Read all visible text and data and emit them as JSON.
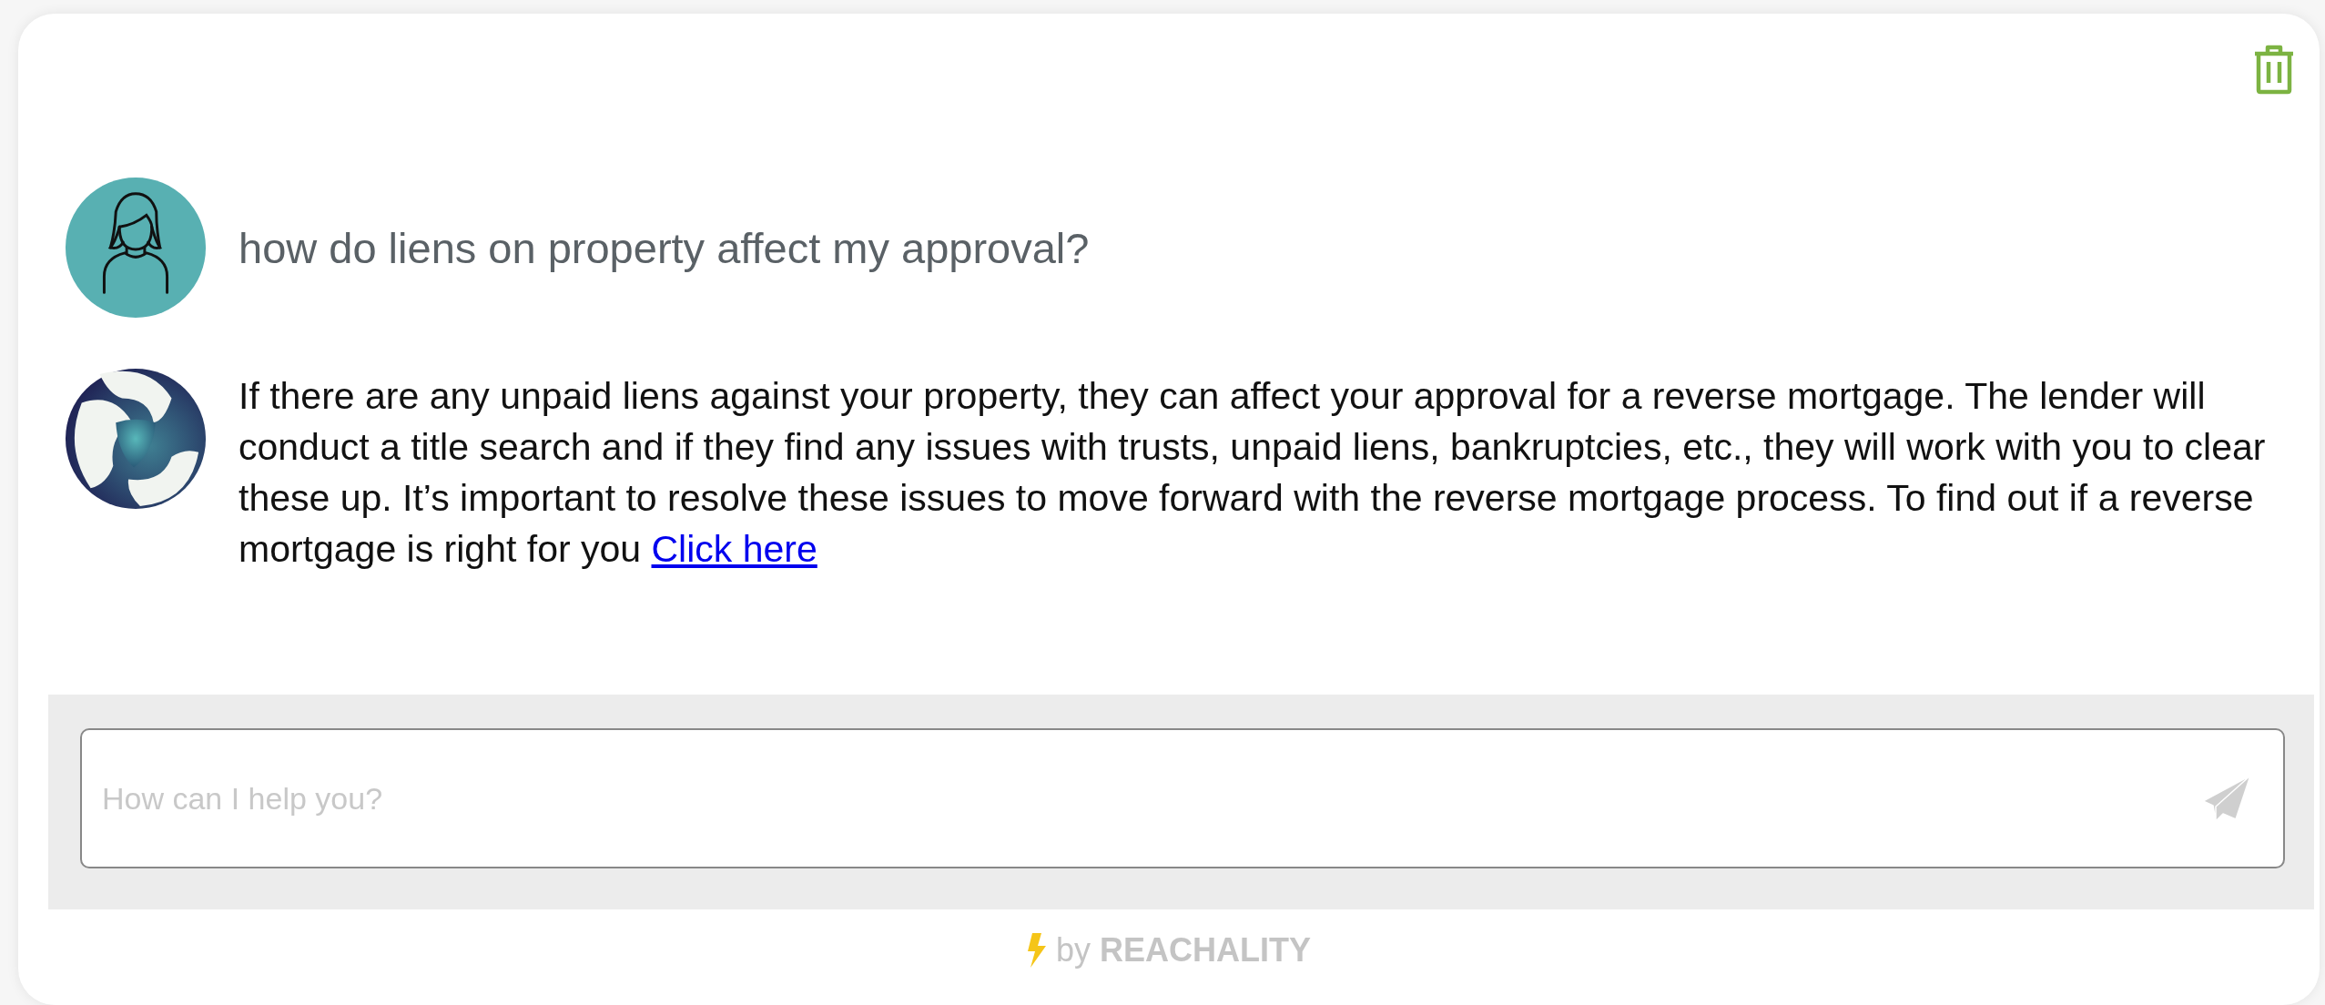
{
  "messages": [
    {
      "kind": "user",
      "text": "how do liens on property affect my approval?"
    },
    {
      "kind": "bot",
      "text": "If there are any unpaid liens against your property, they can affect your approval for a reverse mortgage. The lender will conduct a title search and if they find any issues with trusts, unpaid liens, bankruptcies, etc., they will work with you to clear these up. It’s important to resolve these issues to move forward with the reverse mortgage process. To find out if a reverse mortgage is right for you",
      "link": "Click here"
    }
  ],
  "input": {
    "placeholder": "How can I help you?"
  },
  "footer": {
    "by": "by",
    "brand": "REACHALITY"
  }
}
